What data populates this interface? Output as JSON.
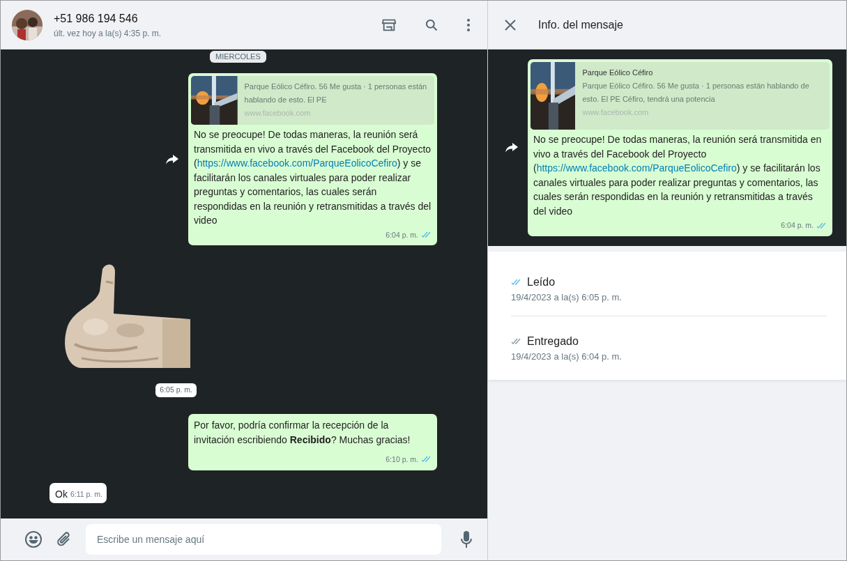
{
  "chat": {
    "contact": {
      "name": "+51 986 194 546",
      "last_seen": "últ. vez hoy a la(s) 4:35 p. m."
    },
    "date_chip": "MIERCOLES",
    "messages": [
      {
        "kind": "link",
        "outgoing": true,
        "forwarded": true,
        "preview": {
          "description": "Parque Eólico Céfiro. 56 Me gusta · 1 personas están hablando de esto. El PE",
          "domain": "www.facebook.com"
        },
        "text_before": "No se preocupe! De todas maneras, la reunión será transmitida en vivo a través del Facebook del Proyecto (",
        "link": "https://www.facebook.com/ParqueEolicoCefiro",
        "text_after": ") y se facilitarán los canales virtuales para poder realizar preguntas y comentarios, las cuales serán respondidas en la reunión y retransmitidas a través del video",
        "time": "6:04 p. m.",
        "read": true
      },
      {
        "kind": "sticker",
        "outgoing": false,
        "time": "6:05 p. m."
      },
      {
        "kind": "text",
        "outgoing": true,
        "text": "Por favor, podría confirmar la recepción de la invitación escribiendo **Recibido**? Muchas gracias!",
        "time": "6:10 p. m.",
        "read": true
      },
      {
        "kind": "text",
        "outgoing": false,
        "text": "Ok",
        "time": "6:11 p. m."
      }
    ],
    "composer": {
      "placeholder": "Escribe un mensaje aquí"
    }
  },
  "info": {
    "title": "Info. del mensaje",
    "message": {
      "kind": "link",
      "outgoing": true,
      "forwarded": true,
      "preview": {
        "title": "Parque Eólico Céfiro",
        "description": "Parque Eólico Céfiro. 56 Me gusta · 1 personas están hablando de esto. El PE Céfiro, tendrá una potencia",
        "domain": "www.facebook.com"
      },
      "text_before": "No se preocupe! De todas maneras, la reunión será transmitida en vivo a través del Facebook del Proyecto (",
      "link": "https://www.facebook.com/ParqueEolicoCefiro",
      "text_after": ") y se facilitarán los canales virtuales para poder realizar preguntas y comentarios, las cuales serán respondidas en la reunión y retransmitidas a través del video",
      "time": "6:04 p. m.",
      "read": true
    },
    "receipts": [
      {
        "label": "Leído",
        "date": "19/4/2023 a la(s) 6:05 p. m.",
        "read": true
      },
      {
        "label": "Entregado",
        "date": "19/4/2023 a la(s) 6:04 p. m.",
        "read": false
      }
    ]
  }
}
